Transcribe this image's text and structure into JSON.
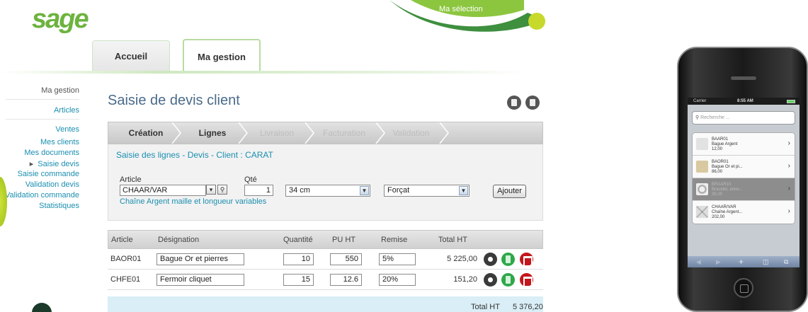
{
  "brand": {
    "logo": "sage",
    "selection_label": "Ma sélection"
  },
  "tabs": [
    {
      "label": "Accueil"
    },
    {
      "label": "Ma gestion"
    }
  ],
  "sidebar": {
    "items": [
      {
        "label": "Ma gestion"
      },
      {
        "label": "Articles"
      },
      {
        "label": "Ventes"
      },
      {
        "label": "Mes clients"
      },
      {
        "label": "Mes documents"
      },
      {
        "label": "Saisie devis"
      },
      {
        "label": "Saisie commande"
      },
      {
        "label": "Validation devis"
      },
      {
        "label": "Validation commande"
      },
      {
        "label": "Statistiques"
      }
    ]
  },
  "page": {
    "title": "Saisie de devis client"
  },
  "steps": [
    {
      "label": "Création",
      "state": "active"
    },
    {
      "label": "Lignes",
      "state": "active"
    },
    {
      "label": "Livraison",
      "state": "disabled"
    },
    {
      "label": "Facturation",
      "state": "disabled"
    },
    {
      "label": "Validation",
      "state": "disabled"
    }
  ],
  "form": {
    "heading": "Saisie des lignes - Devis - Client : CARAT",
    "article_label": "Article",
    "article_value": "CHAAR/VAR",
    "qty_label": "Qté",
    "qty_value": "1",
    "size_value": "34 cm",
    "clasp_value": "Forçat",
    "add_button": "Ajouter",
    "article_description": "Chaîne Argent maille et longueur variables"
  },
  "table": {
    "headers": [
      "Article",
      "Désignation",
      "Quantité",
      "PU HT",
      "Remise",
      "Total HT"
    ],
    "rows": [
      {
        "article": "BAOR01",
        "designation": "Bague Or et pierres",
        "quantity": "10",
        "pu_ht": "550",
        "remise": "5%",
        "total_ht": "5 225,00"
      },
      {
        "article": "CHFE01",
        "designation": "Fermoir cliquet",
        "quantity": "15",
        "pu_ht": "12.6",
        "remise": "20%",
        "total_ht": "151,20"
      }
    ],
    "total_label": "Total HT",
    "total_value": "5 376,20"
  },
  "phone": {
    "carrier": "Carrier",
    "time": "8:55 AM",
    "search_placeholder": "Recherche ...",
    "items": [
      {
        "code": "BAAR01",
        "name": "Bague Argent",
        "price": "12,00",
        "highlighted": false
      },
      {
        "code": "BAOR01",
        "name": "Bague Or et pi...",
        "price": "86,00",
        "highlighted": false
      },
      {
        "code": "BRAAR10",
        "name": "Bracelet, anne...",
        "price": "35,00",
        "highlighted": true
      },
      {
        "code": "CHAAR/VAR",
        "name": "Chaîne Argent...",
        "price": "202,00",
        "highlighted": false
      }
    ]
  },
  "colors": {
    "brand_green": "#6db33f",
    "link_blue": "#1b8fb0",
    "total_bar": "#d9eef6",
    "delete_red": "#c4161c",
    "calc_green": "#2fa84a"
  }
}
